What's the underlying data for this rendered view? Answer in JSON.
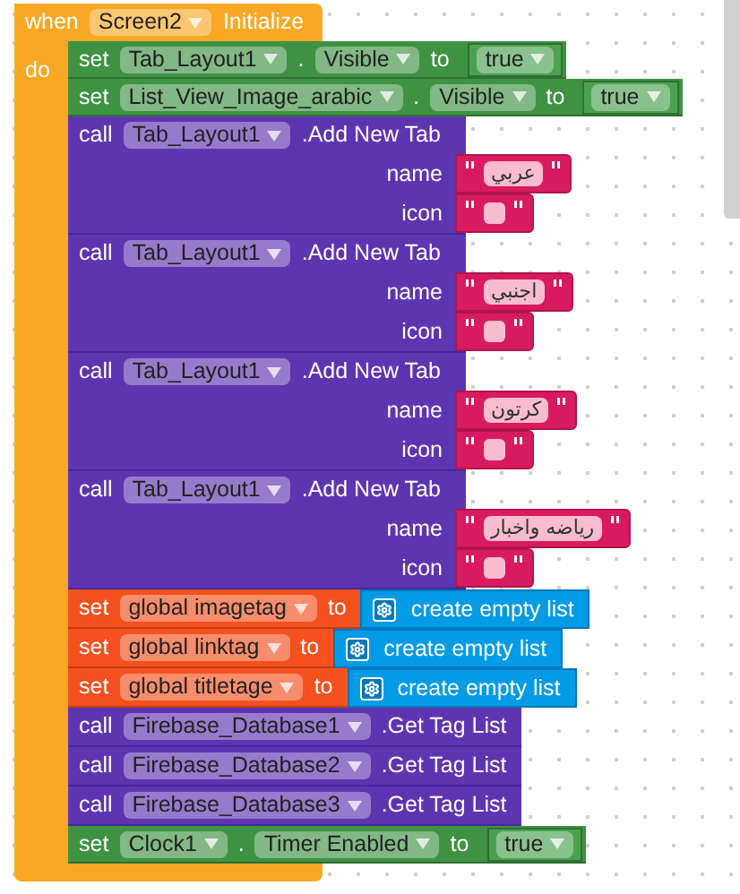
{
  "event": {
    "keyword": "when",
    "component": "Screen2",
    "event": "Initialize",
    "do_label": "do",
    "statements": [
      {
        "kind": "set",
        "keyword": "set",
        "component": "Tab_Layout1",
        "dot": ".",
        "property": "Visible",
        "to": "to",
        "value": "true"
      },
      {
        "kind": "set",
        "keyword": "set",
        "component": "List_View_Image_arabic",
        "dot": ".",
        "property": "Visible",
        "to": "to",
        "value": "true"
      },
      {
        "kind": "call",
        "keyword": "call",
        "component": "Tab_Layout1",
        "method": ".Add New Tab",
        "args": [
          {
            "name": "name",
            "text": "عربي"
          },
          {
            "name": "icon"
          }
        ]
      },
      {
        "kind": "call",
        "keyword": "call",
        "component": "Tab_Layout1",
        "method": ".Add New Tab",
        "args": [
          {
            "name": "name",
            "text": "اجنبي"
          },
          {
            "name": "icon"
          }
        ]
      },
      {
        "kind": "call",
        "keyword": "call",
        "component": "Tab_Layout1",
        "method": ".Add New Tab",
        "args": [
          {
            "name": "name",
            "text": "كرتون"
          },
          {
            "name": "icon"
          }
        ]
      },
      {
        "kind": "call",
        "keyword": "call",
        "component": "Tab_Layout1",
        "method": ".Add New Tab",
        "args": [
          {
            "name": "name",
            "text": "رياضه واخبار"
          },
          {
            "name": "icon"
          }
        ]
      },
      {
        "kind": "set_global",
        "keyword": "set",
        "variable": "global imagetag",
        "to": "to",
        "value": "create empty list"
      },
      {
        "kind": "set_global",
        "keyword": "set",
        "variable": "global linktag",
        "to": "to",
        "value": "create empty list"
      },
      {
        "kind": "set_global",
        "keyword": "set",
        "variable": "global titletage",
        "to": "to",
        "value": "create empty list"
      },
      {
        "kind": "call",
        "keyword": "call",
        "component": "Firebase_Database1",
        "method": ".Get Tag List"
      },
      {
        "kind": "call",
        "keyword": "call",
        "component": "Firebase_Database2",
        "method": ".Get Tag List"
      },
      {
        "kind": "call",
        "keyword": "call",
        "component": "Firebase_Database3",
        "method": ".Get Tag List"
      },
      {
        "kind": "set",
        "keyword": "set",
        "component": "Clock1",
        "dot": ".",
        "property": "Timer Enabled",
        "to": "to",
        "value": "true"
      }
    ]
  }
}
